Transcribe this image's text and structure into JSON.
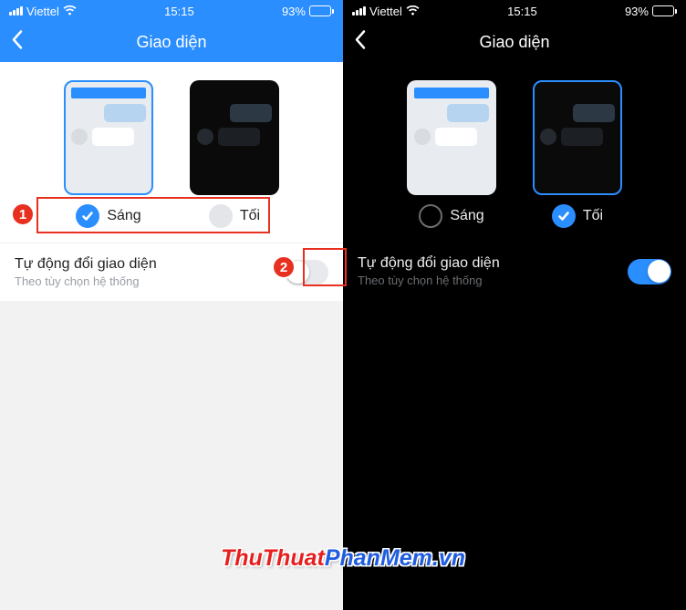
{
  "status": {
    "carrier": "Viettel",
    "time": "15:15",
    "battery_pct": "93%"
  },
  "nav": {
    "title": "Giao diện"
  },
  "themes": {
    "light_label": "Sáng",
    "dark_label": "Tối"
  },
  "auto": {
    "title": "Tự động đổi giao diện",
    "subtitle": "Theo tùy chọn hệ thống"
  },
  "annotations": {
    "badge1": "1",
    "badge2": "2"
  },
  "watermark": {
    "a": "ThuThuat",
    "b": "PhanMem.vn"
  }
}
